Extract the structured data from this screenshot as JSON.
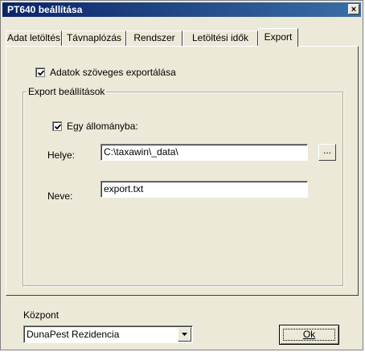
{
  "window": {
    "title": "PT640 beállítása",
    "close_label": "×"
  },
  "tabs": [
    {
      "label": "Adat letöltés"
    },
    {
      "label": "Távnaplózás"
    },
    {
      "label": "Rendszer"
    },
    {
      "label": "Letöltési idők"
    },
    {
      "label": "Export"
    }
  ],
  "active_tab": "Export",
  "export_panel": {
    "text_export": {
      "label": "Adatok szöveges exportálása",
      "checked": true
    },
    "settings_group": {
      "title": "Export beállítások",
      "single_file": {
        "label": "Egy állományba:",
        "checked": true
      },
      "location": {
        "label": "Helye:",
        "value": "C:\\taxawin\\_data\\",
        "browse_label": "..."
      },
      "name": {
        "label": "Neve:",
        "value": "export.txt"
      }
    }
  },
  "footer": {
    "center_label": "Központ",
    "center_value": "DunaPest Rezidencia",
    "ok_label": "Ok"
  }
}
